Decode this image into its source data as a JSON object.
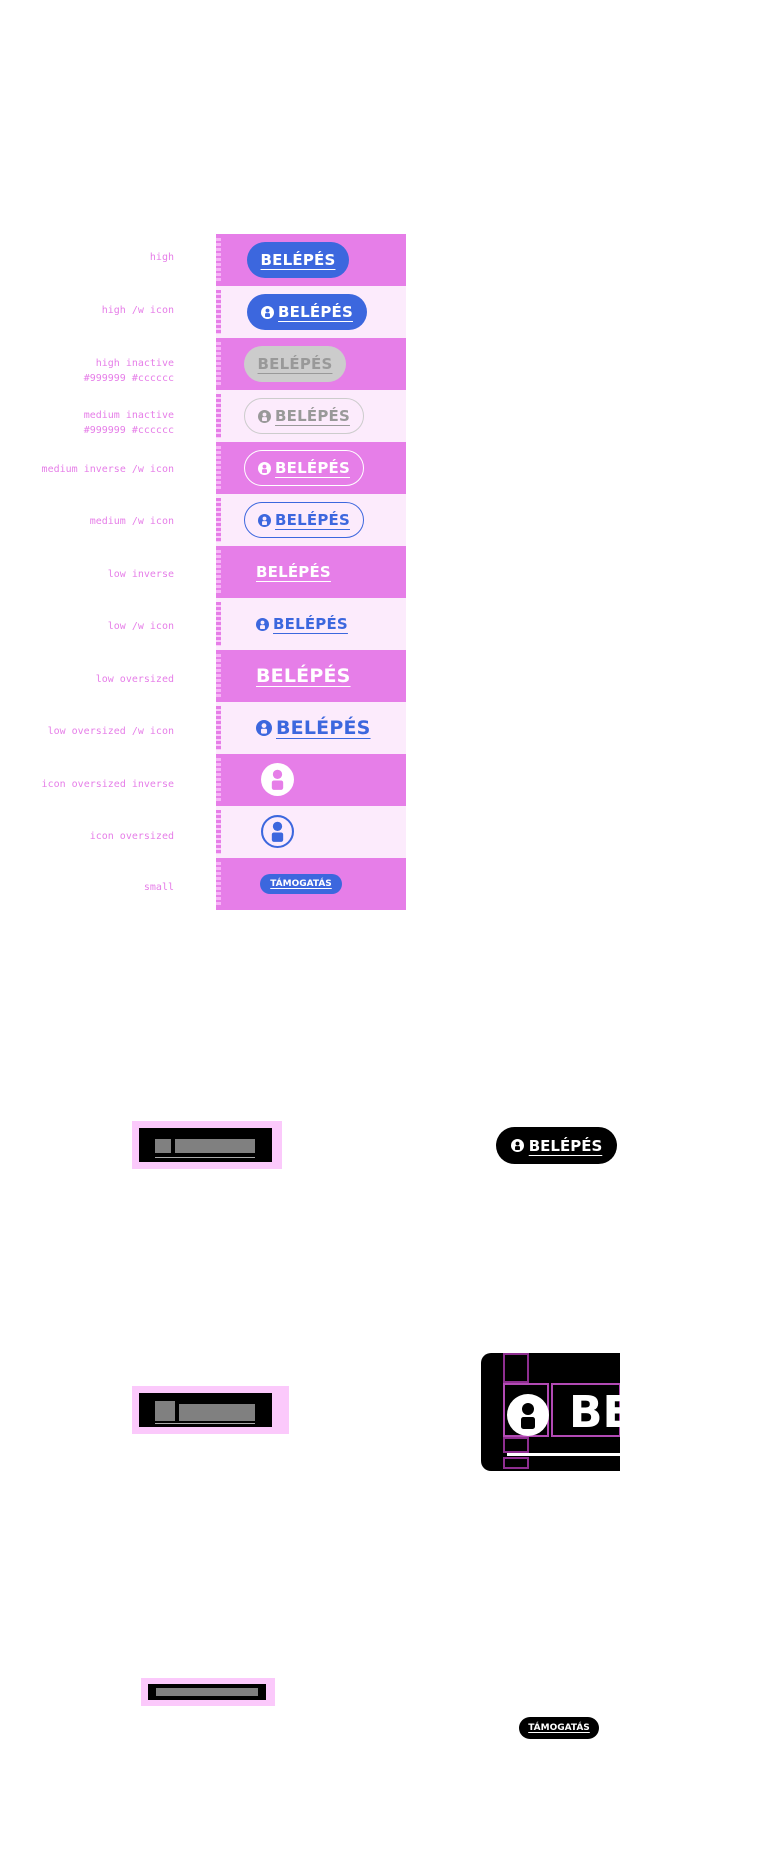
{
  "colors": {
    "accent": "#3c67de",
    "specimen_pink": "#e67ee8",
    "specimen_pink_light": "#fcebfc",
    "inactive_text": "#999999",
    "inactive_fill": "#cccccc",
    "black": "#000000",
    "white": "#ffffff"
  },
  "rows": [
    {
      "label": "high",
      "label2": "",
      "button_text": "BELÉPÉS",
      "icon": "user-icon",
      "has_icon": false
    },
    {
      "label": "high /w icon",
      "label2": "",
      "button_text": "BELÉPÉS",
      "icon": "user-icon",
      "has_icon": true
    },
    {
      "label": "high inactive",
      "label2": "#999999 #cccccc",
      "button_text": "BELÉPÉS",
      "has_icon": false
    },
    {
      "label": "medium inactive",
      "label2": "#999999 #cccccc",
      "button_text": "BELÉPÉS",
      "icon": "user-icon",
      "has_icon": true
    },
    {
      "label": "medium inverse /w icon",
      "label2": "",
      "button_text": "BELÉPÉS",
      "icon": "user-icon",
      "has_icon": true
    },
    {
      "label": "medium /w icon",
      "label2": "",
      "button_text": "BELÉPÉS",
      "icon": "user-icon",
      "has_icon": true
    },
    {
      "label": "low inverse",
      "label2": "",
      "button_text": "BELÉPÉS",
      "has_icon": false
    },
    {
      "label": "low /w icon",
      "label2": "",
      "button_text": "BELÉPÉS",
      "icon": "user-icon",
      "has_icon": true
    },
    {
      "label": "low oversized",
      "label2": "",
      "button_text": "BELÉPÉS",
      "has_icon": false
    },
    {
      "label": "low oversized /w icon",
      "label2": "",
      "button_text": "BELÉPÉS",
      "icon": "user-icon",
      "has_icon": true
    },
    {
      "label": "icon oversized inverse",
      "label2": "",
      "icon": "user-icon"
    },
    {
      "label": "icon oversized",
      "label2": "",
      "icon": "user-icon"
    },
    {
      "label": "small",
      "label2": "",
      "button_text": "TÁMOGATÁS",
      "has_icon": false
    }
  ],
  "examples": {
    "large_pill_text": "BELÉPÉS",
    "zoom_text": "BE",
    "small_pill_text": "TÁMOGATÁS"
  }
}
